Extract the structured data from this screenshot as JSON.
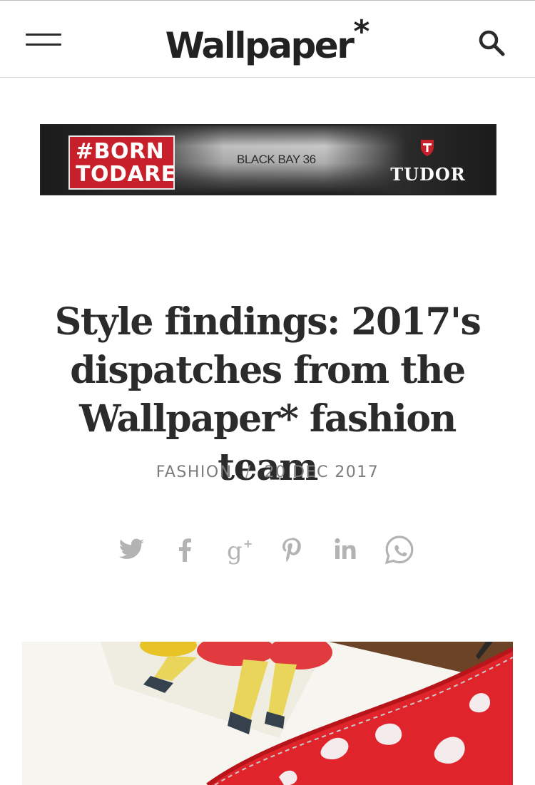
{
  "header": {
    "logo_text": "Wallpaper",
    "logo_star": "*"
  },
  "ad": {
    "tag_line1": "#BORN",
    "tag_line2": "TODARE",
    "model": "BLACK BAY 36",
    "brand": "TUDOR"
  },
  "article": {
    "title_line1": "Style findings: 2017's",
    "title_line2": "dispatches from the",
    "title_line3": "Wallpaper* fashion team",
    "category": "FASHION",
    "separator": "/",
    "date": "20 DEC 2017"
  },
  "share": {
    "icons": [
      "twitter-icon",
      "facebook-icon",
      "google-plus-icon",
      "pinterest-icon",
      "linkedin-icon",
      "whatsapp-icon"
    ],
    "icon_color": "#b3b3b3"
  },
  "colors": {
    "text": "#2a2a2a",
    "meta": "#7c7c7c",
    "ad_red": "#c8202a"
  }
}
